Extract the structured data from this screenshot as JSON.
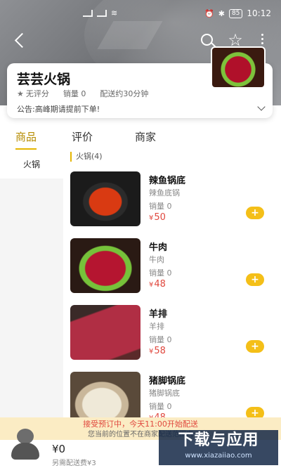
{
  "status_bar": {
    "battery": "85",
    "time": "10:12"
  },
  "store": {
    "name": "芸芸火锅",
    "rating": "无评分",
    "sales": "销量 0",
    "delivery": "配送约30分钟",
    "notice": "公告:高峰期请提前下单!"
  },
  "tabs": [
    {
      "label": "商品",
      "active": true
    },
    {
      "label": "评价",
      "active": false
    },
    {
      "label": "商家",
      "active": false
    }
  ],
  "sidebar": {
    "items": [
      {
        "label": "火锅",
        "active": true
      }
    ]
  },
  "category_header": "火锅(4)",
  "products": [
    {
      "name": "辣鱼锅底",
      "desc": "辣鱼底锅",
      "sales": "销量 0",
      "currency": "¥",
      "price": "50"
    },
    {
      "name": "牛肉",
      "desc": "牛肉",
      "sales": "销量 0",
      "currency": "¥",
      "price": "48"
    },
    {
      "name": "羊排",
      "desc": "羊排",
      "sales": "销量 0",
      "currency": "¥",
      "price": "58"
    },
    {
      "name": "猪脚锅底",
      "desc": "猪脚锅底",
      "sales": "销量 0",
      "currency": "¥",
      "price": "48"
    }
  ],
  "bottom": {
    "preorder_notice": "接受预订中，今天11:00开始配送",
    "location_notice": "您当前的位置不在商家配送范围内",
    "cart_total": "¥0",
    "delivery_fee": "另需配送费¥3"
  },
  "watermark": {
    "title": "下载与应用",
    "url": "www.xiazaiiao.com"
  },
  "colors": {
    "accent": "#e5b500",
    "price": "#e0483e",
    "add_button": "#f4bf18"
  }
}
